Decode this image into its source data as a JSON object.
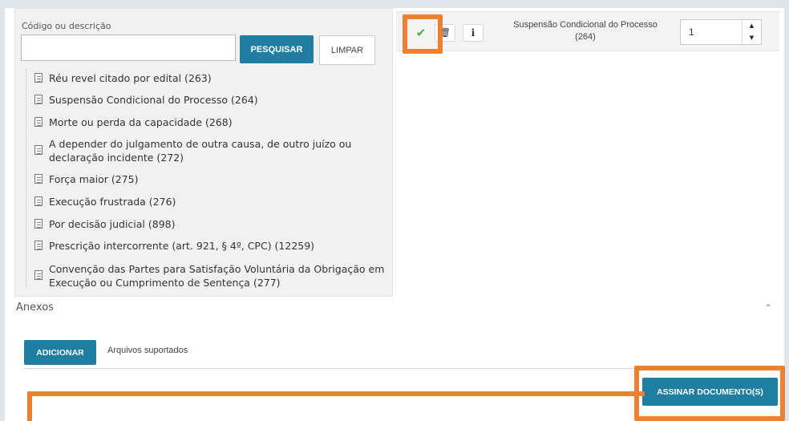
{
  "search": {
    "label": "Código ou descrição",
    "value": "",
    "placeholder": "",
    "search_button": "PESQUISAR",
    "clear_button": "LIMPAR"
  },
  "tree_items": [
    "Réu revel citado por edital (263)",
    "Suspensão Condicional do Processo (264)",
    "Morte ou perda da capacidade (268)",
    "A depender do julgamento de outra causa, de outro juízo ou declaração incidente (272)",
    "Força maior (275)",
    "Execução frustrada (276)",
    "Por decisão judicial (898)",
    "Prescrição intercorrente (art. 921, § 4º, CPC) (12259)",
    "Convenção das Partes para Satisfação Voluntária da Obrigação em Execução ou Cumprimento de Sentença (277)"
  ],
  "selected_row": {
    "check_icon": "✔",
    "trash_icon": "🗑",
    "info_icon": "i",
    "title": "Suspensão Condicional do Processo (264)",
    "quantity": "1",
    "spin_up": "▲",
    "spin_down": "▼"
  },
  "anexos": {
    "title": "Anexos",
    "collapse_icon": "⌃",
    "add_button": "ADICIONAR",
    "supported_label": "Arquivos suportados"
  },
  "footer": {
    "sign_button": "ASSINAR DOCUMENTO(S)"
  },
  "colors": {
    "primary": "#1f7ea1",
    "highlight": "#ec8133",
    "check": "#4caf50"
  }
}
